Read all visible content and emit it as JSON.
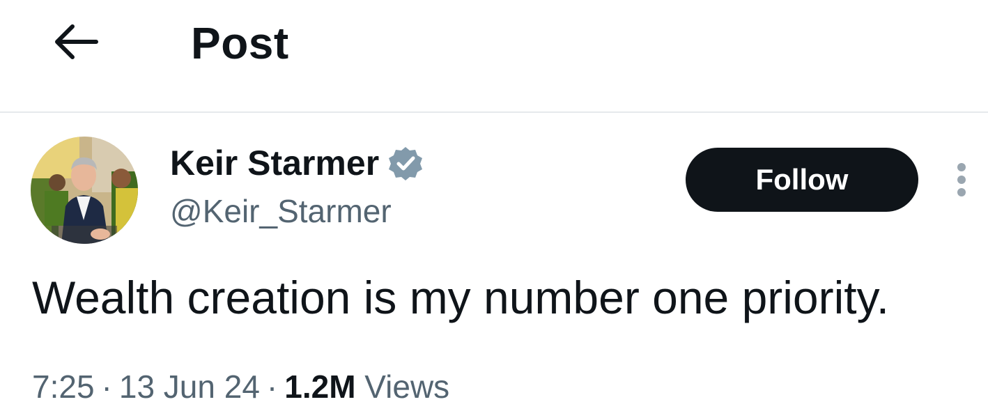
{
  "header": {
    "back_icon": "arrow-left-icon",
    "title": "Post"
  },
  "post": {
    "author": {
      "display_name": "Keir Starmer",
      "handle": "@Keir_Starmer",
      "verified_icon": "verified-badge-icon",
      "verified_color": "#829aab"
    },
    "follow_label": "Follow",
    "more_icon": "more-vertical-icon",
    "text": "Wealth creation is my number one priority.",
    "time": "7:25",
    "separator": "·",
    "date": "13 Jun 24",
    "views_count": "1.2M",
    "views_label": "Views"
  },
  "colors": {
    "text_primary": "#0f1419",
    "text_secondary": "#536471",
    "divider": "#e6e9ec",
    "follow_bg": "#0f1419",
    "follow_text": "#ffffff"
  }
}
